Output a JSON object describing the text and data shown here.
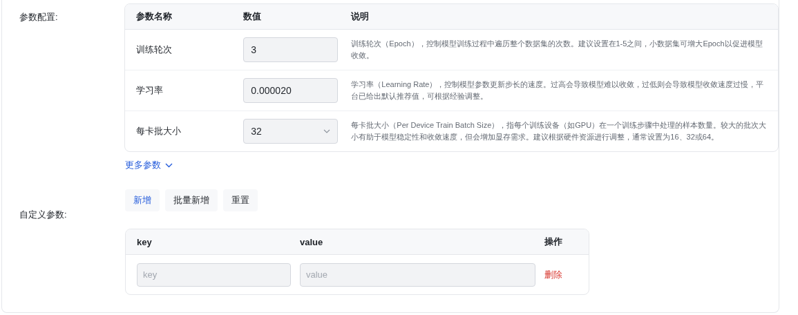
{
  "params_section": {
    "label": "参数配置:",
    "columns": [
      "参数名称",
      "数值",
      "说明"
    ],
    "rows": [
      {
        "name": "训练轮次",
        "kind": "input",
        "value": "3",
        "description": "训练轮次（Epoch），控制模型训练过程中遍历整个数据集的次数。建议设置在1-5之间，小数据集可增大Epoch以促进模型收敛。"
      },
      {
        "name": "学习率",
        "kind": "input",
        "value": "0.000020",
        "description": "学习率（Learning Rate），控制模型参数更新步长的速度。过高会导致模型难以收敛，过低则会导致模型收敛速度过慢，平台已给出默认推荐值，可根据经验调整。"
      },
      {
        "name": "每卡批大小",
        "kind": "select",
        "value": "32",
        "description": "每卡批大小（Per Device Train Batch Size），指每个训练设备（如GPU）在一个训练步骤中处理的样本数量。较大的批次大小有助于模型稳定性和收敛速度，但会增加显存需求。建议根据硬件资源进行调整，通常设置为16、32或64。"
      }
    ],
    "more_link": "更多参数"
  },
  "custom_section": {
    "label": "自定义参数:",
    "buttons": [
      {
        "label": "新增",
        "kind": "primary"
      },
      {
        "label": "批量新增",
        "kind": "default"
      },
      {
        "label": "重置",
        "kind": "default"
      }
    ],
    "columns": [
      "key",
      "value",
      "操作"
    ],
    "rows": [
      {
        "key_placeholder": "key",
        "value_placeholder": "value",
        "action": "删除"
      }
    ]
  }
}
